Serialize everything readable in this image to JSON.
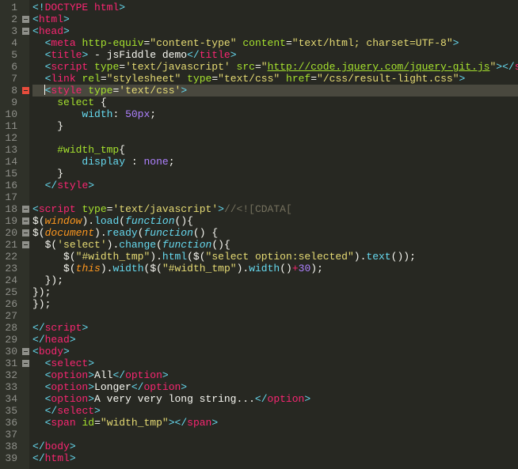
{
  "lines": {
    "n1": "1",
    "n2": "2",
    "n3": "3",
    "n4": "4",
    "n5": "5",
    "n6": "6",
    "n7": "7",
    "n8": "8",
    "n9": "9",
    "n10": "10",
    "n11": "11",
    "n12": "12",
    "n13": "13",
    "n14": "14",
    "n15": "15",
    "n16": "16",
    "n17": "17",
    "n18": "18",
    "n19": "19",
    "n20": "20",
    "n21": "21",
    "n22": "22",
    "n23": "23",
    "n24": "24",
    "n25": "25",
    "n26": "26",
    "n27": "27",
    "n28": "28",
    "n29": "29",
    "n30": "30",
    "n31": "31",
    "n32": "32",
    "n33": "33",
    "n34": "34",
    "n35": "35",
    "n36": "36",
    "n37": "37",
    "n38": "38",
    "n39": "39"
  },
  "t": {
    "doctype_open": "<!",
    "doctype": "DOCTYPE",
    "sp": " ",
    "html_txt": "html",
    "gt": ">",
    "lt": "<",
    "slash": "/",
    "close": ">",
    "head": "head",
    "meta": "meta",
    "http_equiv": "http-equiv",
    "eq": "=",
    "q": "\"",
    "content_type": "content-type",
    "content": "content",
    "ct_val": "text/html; charset=UTF-8",
    "title": "title",
    "title_txt": " - jsFiddle demo",
    "script": "script",
    "type": "type",
    "sq": "'",
    "text_js": "text/javascript",
    "src": "src",
    "url_jq": "http://code.jquery.com/jquery-git.js",
    "link": "link",
    "rel": "rel",
    "stylesheet": "stylesheet",
    "text_css": "text/css",
    "href": "href",
    "css_href": "/css/result-light.css",
    "style": "style",
    "sel_select": "select",
    "brace_o": "{",
    "brace_c": "}",
    "width_prop": "width",
    "colon": ":",
    "fifty": "50px",
    "semi": ";",
    "sel_widthtmp": "#width_tmp",
    "display": "display",
    "none": "none",
    "cdata": "//<![CDATA[",
    "dollar": "$",
    "paren_o": "(",
    "paren_c": ")",
    "window": "window",
    "dot": ".",
    "load": "load",
    "function": "function",
    "document": "document",
    "ready": "ready",
    "sel_str": "'select'",
    "change": "change",
    "wt_str": "\"#width_tmp\"",
    "html_fn": "html",
    "sel_opt_str": "\"select option:selected\"",
    "text_fn": "text",
    "this": "this",
    "width_fn": "width",
    "plus": "+",
    "thirty": "30",
    "brace_c_p": "});",
    "body": "body",
    "select_tag": "select",
    "option": "option",
    "opt1": "All",
    "opt2": "Longer",
    "opt3": "A very very long string...",
    "span": "span",
    "id": "id",
    "width_tmp_id": "width_tmp"
  }
}
